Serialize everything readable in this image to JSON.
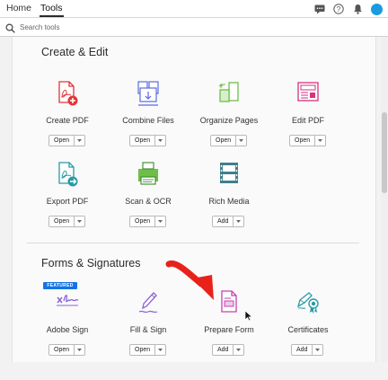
{
  "tabs": [
    {
      "label": "Home"
    },
    {
      "label": "Tools"
    }
  ],
  "toolbar_icons": [
    "chat-icon",
    "help-icon",
    "bell-icon",
    "avatar"
  ],
  "search": {
    "placeholder": "Search tools",
    "value": ""
  },
  "sections": [
    {
      "title": "Create & Edit",
      "tools": [
        {
          "label": "Create PDF",
          "button": "Open",
          "icon": "create-pdf-icon"
        },
        {
          "label": "Combine Files",
          "button": "Open",
          "icon": "combine-files-icon"
        },
        {
          "label": "Organize Pages",
          "button": "Open",
          "icon": "organize-pages-icon"
        },
        {
          "label": "Edit PDF",
          "button": "Open",
          "icon": "edit-pdf-icon"
        },
        {
          "label": "Export PDF",
          "button": "Open",
          "icon": "export-pdf-icon"
        },
        {
          "label": "Scan & OCR",
          "button": "Open",
          "icon": "scan-ocr-icon"
        },
        {
          "label": "Rich Media",
          "button": "Add",
          "icon": "rich-media-icon"
        }
      ]
    },
    {
      "title": "Forms & Signatures",
      "tools": [
        {
          "label": "Adobe Sign",
          "button": "Open",
          "icon": "adobe-sign-icon",
          "badge": "FEATURED"
        },
        {
          "label": "Fill & Sign",
          "button": "Open",
          "icon": "fill-sign-icon"
        },
        {
          "label": "Prepare Form",
          "button": "Add",
          "icon": "prepare-form-icon"
        },
        {
          "label": "Certificates",
          "button": "Add",
          "icon": "certificates-icon"
        }
      ]
    }
  ],
  "colors": {
    "red": "#e3343a",
    "blue": "#5a6be0",
    "green": "#6fbe4a",
    "pink": "#d6327f",
    "teal": "#2a9aa5",
    "slate": "#3f7f8c",
    "purple": "#8c62d6",
    "magenta": "#c341b3",
    "badge": "#1473e6"
  }
}
